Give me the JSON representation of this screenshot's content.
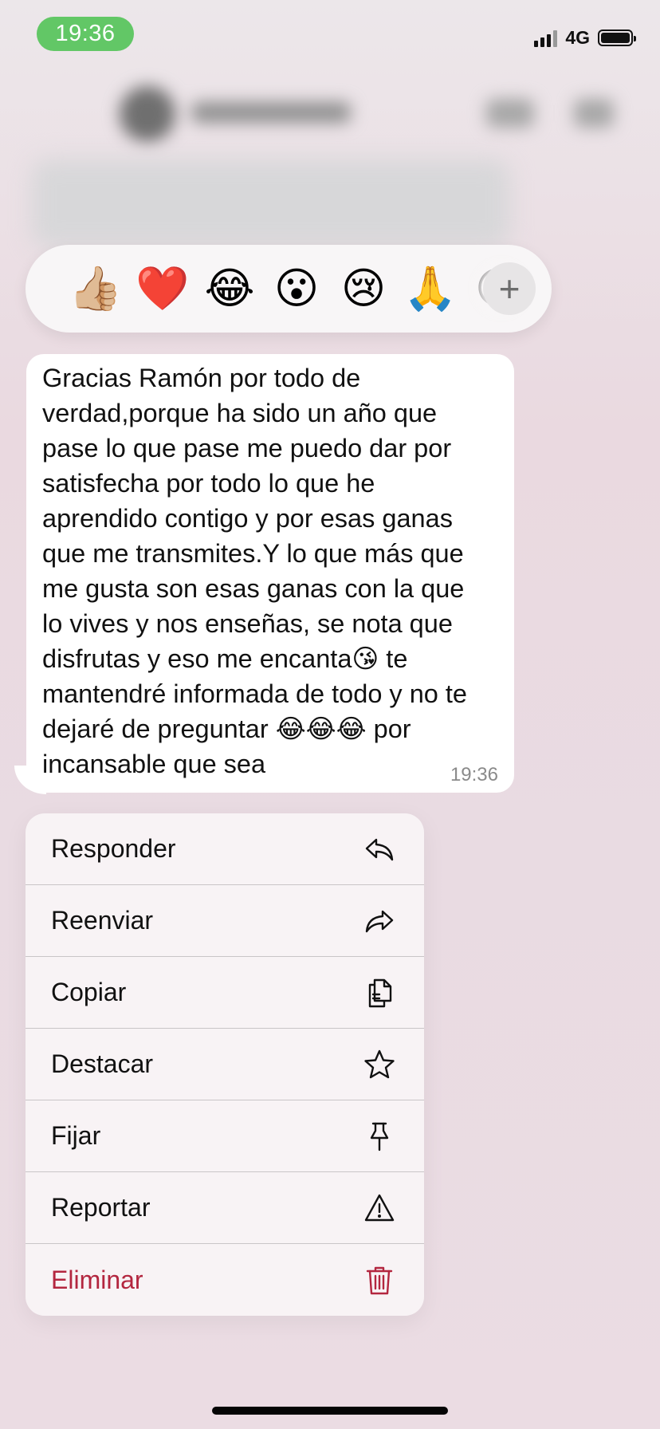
{
  "status_bar": {
    "time": "19:36",
    "network": "4G"
  },
  "reactions": {
    "emojis": [
      "👍🏼",
      "❤️",
      "😂",
      "😮",
      "😢",
      "🙏",
      "😊"
    ],
    "add_label": "+"
  },
  "message": {
    "text": "Gracias Ramón por todo de\nverdad,porque ha sido un año que\npase lo que pase me puedo dar por\nsatisfecha por todo lo que he\naprendido contigo y por esas ganas\nque me transmites.Y lo que más que\nme gusta son esas ganas con la que\nlo vives y nos enseñas, se nota que\ndisfrutas y eso me encanta😘 te\nmantendré informada de todo y no te\ndejaré de preguntar 😂😂😂 por\nincansable que sea",
    "time": "19:36"
  },
  "menu": {
    "items": [
      {
        "label": "Responder",
        "icon": "reply-icon"
      },
      {
        "label": "Reenviar",
        "icon": "forward-icon"
      },
      {
        "label": "Copiar",
        "icon": "copy-icon"
      },
      {
        "label": "Destacar",
        "icon": "star-icon"
      },
      {
        "label": "Fijar",
        "icon": "pin-icon"
      },
      {
        "label": "Reportar",
        "icon": "warning-icon"
      },
      {
        "label": "Eliminar",
        "icon": "trash-icon"
      }
    ],
    "danger_color": "#b3263f"
  },
  "colors": {
    "time_pill": "#62c766",
    "bubble": "#ffffff"
  }
}
